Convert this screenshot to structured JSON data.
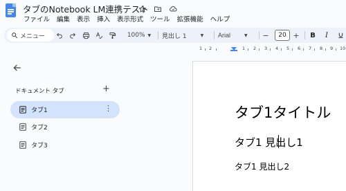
{
  "document": {
    "title": "タブのNotebook LM連携テスト"
  },
  "menu": [
    "ファイル",
    "編集",
    "表示",
    "挿入",
    "表示形式",
    "ツール",
    "拡張機能",
    "ヘルプ"
  ],
  "toolbar": {
    "search_label": "メニュー",
    "zoom": "100%",
    "style": "見出し 1",
    "font": "Arial",
    "font_size": "20",
    "minus": "−",
    "plus": "+",
    "bold": "B",
    "italic": "I"
  },
  "ruler": {
    "labels": [
      "1",
      "2",
      "1",
      "2",
      "3",
      "4",
      "5",
      "6",
      "7",
      "8",
      "9",
      "10"
    ]
  },
  "sidebar": {
    "heading": "ドキュメント タブ",
    "add_label": "+",
    "tabs": [
      {
        "label": "タブ1",
        "active": true
      },
      {
        "label": "タブ2",
        "active": false
      },
      {
        "label": "タブ3",
        "active": false
      }
    ]
  },
  "content": {
    "title": "タブ1タイトル",
    "heading1": "タブ1 見出し1",
    "heading2": "タブ1 見出し2"
  },
  "colors": {
    "accent": "#4285f4",
    "active_tab": "#d3e3fd",
    "toolbar": "#edf2fa"
  }
}
